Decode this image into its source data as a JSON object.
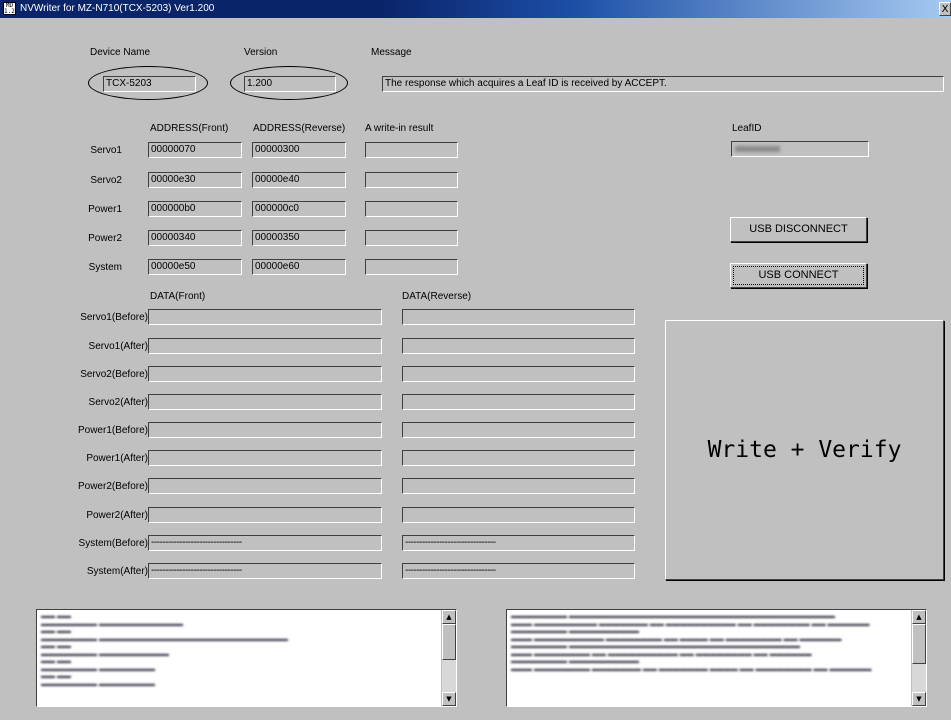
{
  "window": {
    "title": "NVWriter for MZ-N710(TCX-5203) Ver1.200",
    "icon_text": "MD 1.20",
    "close_label": "X"
  },
  "header": {
    "device_name_label": "Device Name",
    "device_name_value": "TCX-5203",
    "version_label": "Version",
    "version_value": "1.200",
    "message_label": "Message",
    "message_value": "The response which acquires a Leaf ID is received by ACCEPT."
  },
  "address_table": {
    "col_front": "ADDRESS(Front)",
    "col_reverse": "ADDRESS(Reverse)",
    "col_result": "A write-in result",
    "rows": [
      {
        "label": "Servo1",
        "front": "00000070",
        "reverse": "00000300",
        "result": ""
      },
      {
        "label": "Servo2",
        "front": "00000e30",
        "reverse": "00000e40",
        "result": ""
      },
      {
        "label": "Power1",
        "front": "000000b0",
        "reverse": "000000c0",
        "result": ""
      },
      {
        "label": "Power2",
        "front": "00000340",
        "reverse": "00000350",
        "result": ""
      },
      {
        "label": "System",
        "front": "00000e50",
        "reverse": "00000e60",
        "result": ""
      }
    ]
  },
  "leaf": {
    "label": "LeafID"
  },
  "buttons": {
    "usb_disconnect": "USB DISCONNECT",
    "usb_connect": "USB CONNECT",
    "write_verify": "Write + Verify"
  },
  "data_table": {
    "col_front": "DATA(Front)",
    "col_reverse": "DATA(Reverse)",
    "rows": [
      {
        "label": "Servo1(Before)",
        "front": "",
        "reverse": ""
      },
      {
        "label": "Servo1(After)",
        "front": "",
        "reverse": ""
      },
      {
        "label": "Servo2(Before)",
        "front": "",
        "reverse": ""
      },
      {
        "label": "Servo2(After)",
        "front": "",
        "reverse": ""
      },
      {
        "label": "Power1(Before)",
        "front": "",
        "reverse": ""
      },
      {
        "label": "Power1(After)",
        "front": "",
        "reverse": ""
      },
      {
        "label": "Power2(Before)",
        "front": "",
        "reverse": ""
      },
      {
        "label": "Power2(After)",
        "front": "",
        "reverse": ""
      },
      {
        "label": "System(Before)",
        "front": "--------------------------------",
        "reverse": "--------------------------------"
      },
      {
        "label": "System(After)",
        "front": "--------------------------------",
        "reverse": "--------------------------------"
      }
    ]
  },
  "scroll_glyphs": {
    "up": "▲",
    "down": "▼"
  }
}
